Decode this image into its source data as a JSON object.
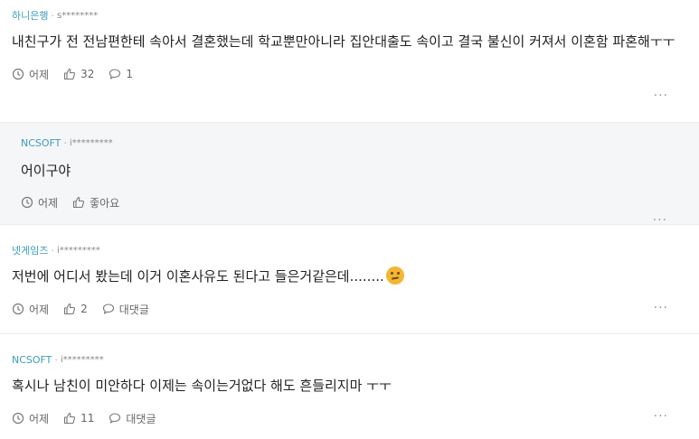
{
  "comments": [
    {
      "author": "하니은행",
      "user_id": "s********",
      "text": "내친구가 전 전남편한테 속아서 결혼했는데 학교뿐만아니라 집안대출도 속이고 결국 불신이 커져서 이혼함 파혼해ㅜㅜ",
      "time": "어제",
      "likes": "32",
      "replies": "1",
      "more": "···"
    },
    {
      "author": "NCSOFT",
      "user_id": "i*********",
      "text": "어이구야",
      "time": "어제",
      "likes": "좋아요",
      "more": "···"
    },
    {
      "author": "넷게임즈",
      "user_id": "i*********",
      "text": "저번에 어디서 봤는데 이거 이혼사유도 된다고 들은거같은데........",
      "emoji": "thinking-face",
      "time": "어제",
      "likes": "2",
      "replies": "대댓글",
      "more": "···"
    },
    {
      "author": "NCSOFT",
      "user_id": "i*********",
      "text": "혹시나 남친이 미안하다 이제는 속이는거없다 해도 흔들리지마 ㅜㅜ",
      "time": "어제",
      "likes": "11",
      "replies": "대댓글",
      "more": "···"
    }
  ],
  "colors": {
    "author": "#3d9cb8",
    "reply_bg": "#f5f6f8",
    "meta_text": "#666666"
  }
}
